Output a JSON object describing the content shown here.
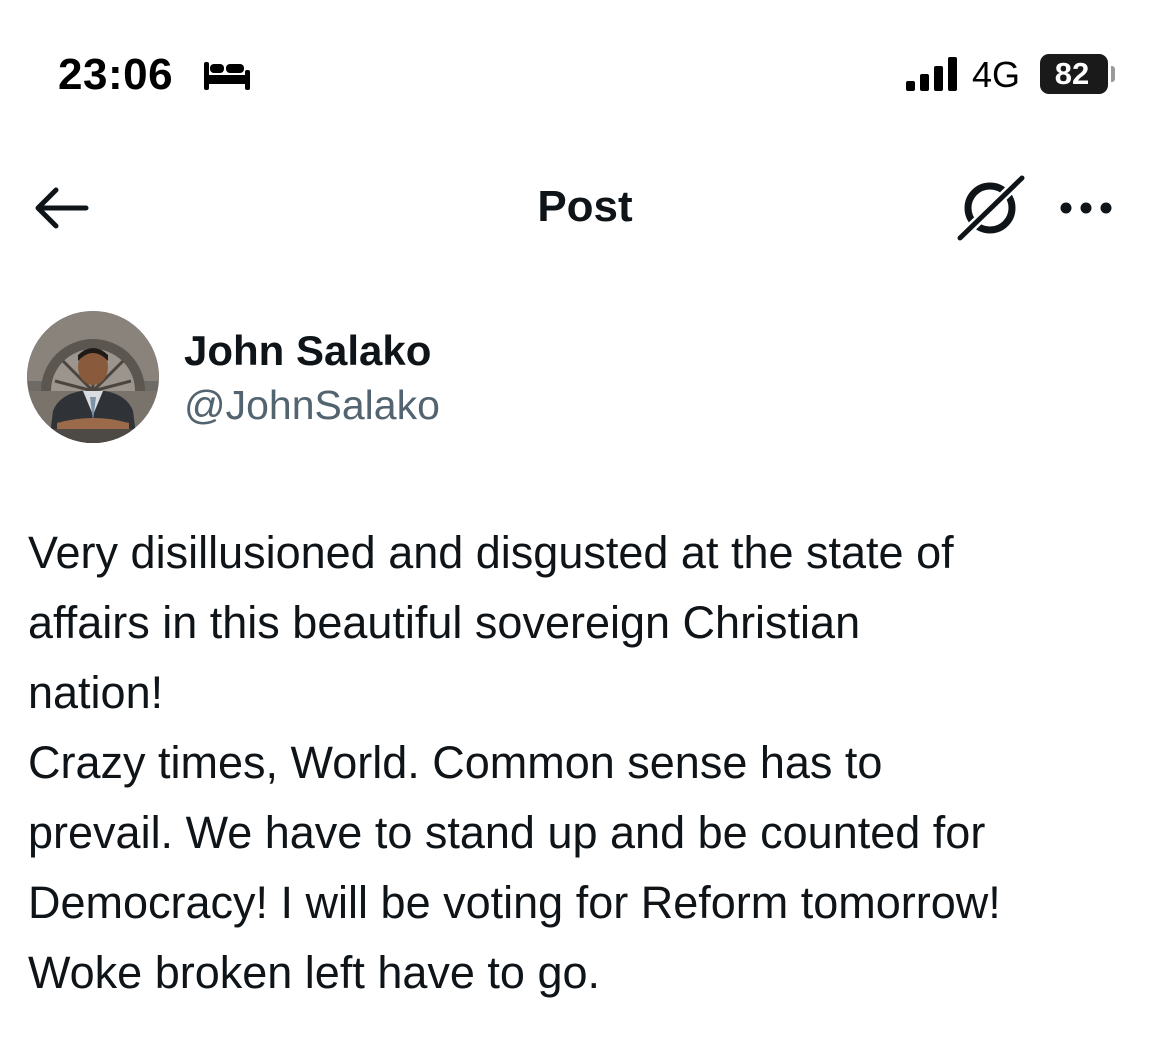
{
  "status_bar": {
    "time": "23:06",
    "focus_icon": "bed-icon",
    "signal_icon": "signal-bars-icon",
    "network": "4G",
    "battery": "82"
  },
  "header": {
    "back_icon": "back-arrow-icon",
    "title": "Post",
    "grok_icon": "grok-icon",
    "more_icon": "more-dots-icon"
  },
  "post": {
    "author": {
      "name": "John Salako",
      "handle": "@JohnSalako",
      "avatar_icon": "avatar-photo"
    },
    "text_lines": [
      "Very disillusioned and disgusted at the state of",
      "affairs in this beautiful sovereign Christian",
      "nation!",
      "Crazy times, World. Common sense has to",
      "prevail. We have to stand up and be counted for",
      "Democracy! I will be voting for Reform tomorrow!",
      "Woke broken left have to go."
    ]
  },
  "colors": {
    "text_primary": "#0f1419",
    "text_secondary": "#536471",
    "background": "#ffffff"
  }
}
